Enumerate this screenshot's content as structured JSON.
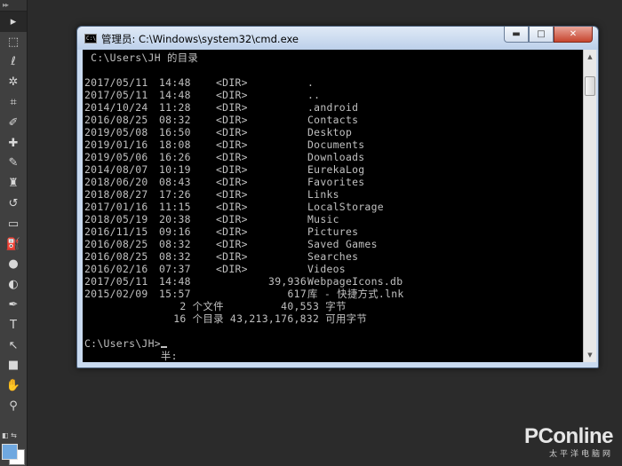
{
  "tools": [
    {
      "icon": "move-icon",
      "glyph": "▸"
    },
    {
      "icon": "marquee-icon",
      "glyph": "⬚"
    },
    {
      "icon": "lasso-icon",
      "glyph": "ℓ"
    },
    {
      "icon": "magic-wand-icon",
      "glyph": "✲"
    },
    {
      "icon": "crop-icon",
      "glyph": "⌗"
    },
    {
      "icon": "eyedropper-icon",
      "glyph": "✐"
    },
    {
      "icon": "healing-brush-icon",
      "glyph": "✚"
    },
    {
      "icon": "brush-icon",
      "glyph": "✎"
    },
    {
      "icon": "clone-stamp-icon",
      "glyph": "♜"
    },
    {
      "icon": "history-brush-icon",
      "glyph": "↺"
    },
    {
      "icon": "eraser-icon",
      "glyph": "▭"
    },
    {
      "icon": "paint-bucket-icon",
      "glyph": "⛽"
    },
    {
      "icon": "blur-icon",
      "glyph": "●"
    },
    {
      "icon": "dodge-icon",
      "glyph": "◐"
    },
    {
      "icon": "pen-icon",
      "glyph": "✒"
    },
    {
      "icon": "type-icon",
      "glyph": "T"
    },
    {
      "icon": "path-selection-icon",
      "glyph": "↖"
    },
    {
      "icon": "rectangle-icon",
      "glyph": "■"
    },
    {
      "icon": "hand-icon",
      "glyph": "✋"
    },
    {
      "icon": "zoom-icon",
      "glyph": "⚲"
    }
  ],
  "window": {
    "title": "管理员: C:\\Windows\\system32\\cmd.exe",
    "minimize": "▬",
    "maximize": "□",
    "close": "✕"
  },
  "console": {
    "header": " C:\\Users\\JH 的目录",
    "entries": [
      {
        "date": "2017/05/11",
        "time": "14:48",
        "dir": "<DIR>",
        "size": "",
        "name": "."
      },
      {
        "date": "2017/05/11",
        "time": "14:48",
        "dir": "<DIR>",
        "size": "",
        "name": ".."
      },
      {
        "date": "2014/10/24",
        "time": "11:28",
        "dir": "<DIR>",
        "size": "",
        "name": ".android"
      },
      {
        "date": "2016/08/25",
        "time": "08:32",
        "dir": "<DIR>",
        "size": "",
        "name": "Contacts"
      },
      {
        "date": "2019/05/08",
        "time": "16:50",
        "dir": "<DIR>",
        "size": "",
        "name": "Desktop"
      },
      {
        "date": "2019/01/16",
        "time": "18:08",
        "dir": "<DIR>",
        "size": "",
        "name": "Documents"
      },
      {
        "date": "2019/05/06",
        "time": "16:26",
        "dir": "<DIR>",
        "size": "",
        "name": "Downloads"
      },
      {
        "date": "2014/08/07",
        "time": "10:19",
        "dir": "<DIR>",
        "size": "",
        "name": "EurekaLog"
      },
      {
        "date": "2018/06/20",
        "time": "08:43",
        "dir": "<DIR>",
        "size": "",
        "name": "Favorites"
      },
      {
        "date": "2018/08/27",
        "time": "17:26",
        "dir": "<DIR>",
        "size": "",
        "name": "Links"
      },
      {
        "date": "2017/01/16",
        "time": "11:15",
        "dir": "<DIR>",
        "size": "",
        "name": "LocalStorage"
      },
      {
        "date": "2018/05/19",
        "time": "20:38",
        "dir": "<DIR>",
        "size": "",
        "name": "Music"
      },
      {
        "date": "2016/11/15",
        "time": "09:16",
        "dir": "<DIR>",
        "size": "",
        "name": "Pictures"
      },
      {
        "date": "2016/08/25",
        "time": "08:32",
        "dir": "<DIR>",
        "size": "",
        "name": "Saved Games"
      },
      {
        "date": "2016/08/25",
        "time": "08:32",
        "dir": "<DIR>",
        "size": "",
        "name": "Searches"
      },
      {
        "date": "2016/02/16",
        "time": "07:37",
        "dir": "<DIR>",
        "size": "",
        "name": "Videos"
      },
      {
        "date": "2017/05/11",
        "time": "14:48",
        "dir": "",
        "size": "39,936",
        "name": "WebpageIcons.db"
      },
      {
        "date": "2015/02/09",
        "time": "15:57",
        "dir": "",
        "size": "617",
        "name": "库 - 快捷方式.lnk"
      }
    ],
    "summary_files": "               2 个文件         40,553 字节",
    "summary_dirs": "              16 个目录 43,213,176,832 可用字节",
    "prompt": "C:\\Users\\JH>",
    "ime": "            半:"
  },
  "watermark": {
    "logo": "PConline",
    "sub": "太平洋电脑网"
  },
  "colors": {
    "console_bg": "#000000",
    "console_text": "#c0c0c0",
    "foreground_swatch": "#6fa8e0"
  }
}
